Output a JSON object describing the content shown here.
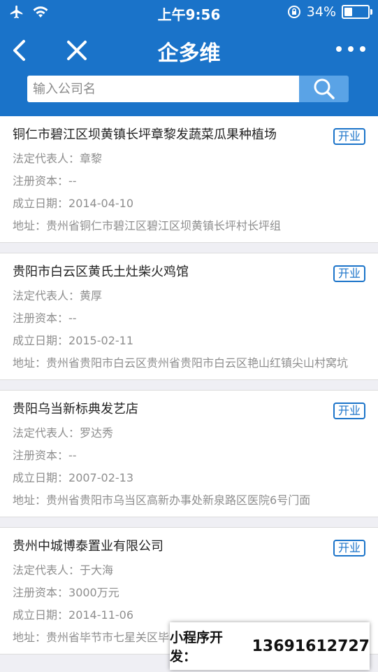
{
  "status_bar": {
    "time": "上午9:56",
    "battery": "34%",
    "battery_level": 0.34
  },
  "nav": {
    "title": "企多维"
  },
  "search": {
    "placeholder": "输入公司名"
  },
  "labels": {
    "legal_rep": "法定代表人：",
    "capital": "注册资本：",
    "founded": "成立日期：",
    "address": "地址："
  },
  "companies": [
    {
      "name": "铜仁市碧江区坝黄镇长坪章黎发蔬菜瓜果种植场",
      "status": "开业",
      "legal_rep": "章黎",
      "capital": "--",
      "founded": "2014-04-10",
      "address": "贵州省铜仁市碧江区碧江区坝黄镇长坪村长坪组"
    },
    {
      "name": "贵阳市白云区黄氏土灶柴火鸡馆",
      "status": "开业",
      "legal_rep": "黄厚",
      "capital": "--",
      "founded": "2015-02-11",
      "address": "贵州省贵阳市白云区贵州省贵阳市白云区艳山红镇尖山村窝坑"
    },
    {
      "name": "贵阳乌当新标典发艺店",
      "status": "开业",
      "legal_rep": "罗达秀",
      "capital": "--",
      "founded": "2007-02-13",
      "address": "贵州省贵阳市乌当区高新办事处新泉路区医院6号门面"
    },
    {
      "name": "贵州中城博泰置业有限公司",
      "status": "开业",
      "legal_rep": "于大海",
      "capital": "3000万元",
      "founded": "2014-11-06",
      "address": "贵州省毕节市七星关区毕节市七星关区双田……"
    }
  ],
  "promo": {
    "label": "小程序开发：",
    "phone": "13691612727"
  }
}
